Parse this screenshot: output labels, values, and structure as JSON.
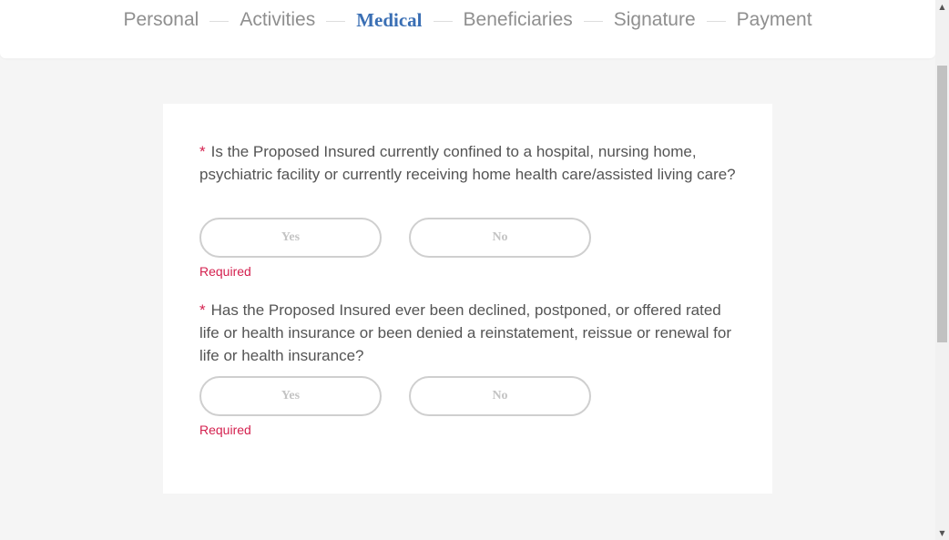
{
  "steps": [
    {
      "label": "Personal",
      "active": false
    },
    {
      "label": "Activities",
      "active": false
    },
    {
      "label": "Medical",
      "active": true
    },
    {
      "label": "Beneficiaries",
      "active": false
    },
    {
      "label": "Signature",
      "active": false
    },
    {
      "label": "Payment",
      "active": false
    }
  ],
  "colors": {
    "active_step": "#3a6fb4",
    "inactive_step": "#8f8f8f",
    "required": "#d4214f",
    "background": "#f5f5f5"
  },
  "questions": [
    {
      "required_marker": "*",
      "text": "Is the Proposed Insured currently confined to a hospital, nursing home, psychiatric facility or currently receiving home health care/assisted living care?",
      "yes_label": "Yes",
      "no_label": "No",
      "error": "Required"
    },
    {
      "required_marker": "*",
      "text": "Has the Proposed Insured ever been declined, postponed, or offered rated life or health insurance or been denied a reinstatement, reissue or renewal for life or health insurance?",
      "yes_label": "Yes",
      "no_label": "No",
      "error": "Required"
    }
  ],
  "scrollbar": {
    "up_icon": "▲",
    "down_icon": "▼"
  }
}
